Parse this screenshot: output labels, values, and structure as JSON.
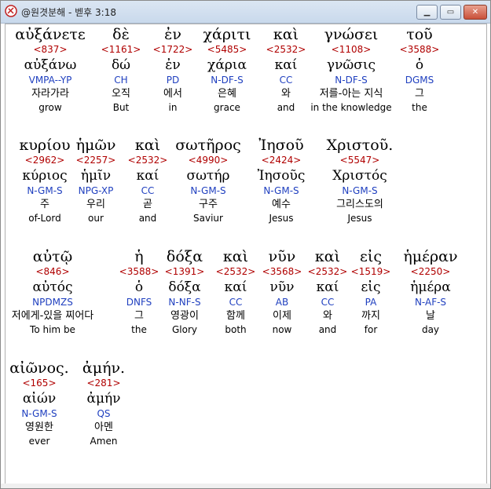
{
  "window": {
    "title": "@원겻분해 - 벧후 3:18"
  },
  "words": [
    {
      "greek": "αὐξάνετε",
      "num": "<837>",
      "lemma": "αὐξάνω",
      "parse": "VMPA--YP",
      "kor": "자라가라",
      "eng": "grow"
    },
    {
      "greek": "δὲ",
      "num": "<1161>",
      "lemma": "δώ",
      "parse": "CH",
      "kor": "오직",
      "eng": "But"
    },
    {
      "greek": "ἐν",
      "num": "<1722>",
      "lemma": "ἐν",
      "parse": "PD",
      "kor": "에서",
      "eng": "in"
    },
    {
      "greek": "χάριτι",
      "num": "<5485>",
      "lemma": "χάρια",
      "parse": "N-DF-S",
      "kor": "은혜",
      "eng": "grace"
    },
    {
      "greek": "καὶ",
      "num": "<2532>",
      "lemma": "καί",
      "parse": "CC",
      "kor": "와",
      "eng": "and"
    },
    {
      "greek": "γνώσει",
      "num": "<1108>",
      "lemma": "γνῶσις",
      "parse": "N-DF-S",
      "kor": "저를-아는 지식",
      "eng": "in the knowledge"
    },
    {
      "greek": "τοῦ",
      "num": "<3588>",
      "lemma": "ὁ",
      "parse": "DGMS",
      "kor": "그",
      "eng": "the"
    },
    {
      "greek": "κυρίου",
      "num": "<2962>",
      "lemma": "κύριος",
      "parse": "N-GM-S",
      "kor": "주",
      "eng": "of-Lord"
    },
    {
      "greek": "ἡμῶν",
      "num": "<2257>",
      "lemma": "ἡμῖν",
      "parse": "NPG-XP",
      "kor": "우리",
      "eng": "our"
    },
    {
      "greek": "καὶ",
      "num": "<2532>",
      "lemma": "καί",
      "parse": "CC",
      "kor": "곧",
      "eng": "and"
    },
    {
      "greek": "σωτῆρος",
      "num": "<4990>",
      "lemma": "σωτήρ",
      "parse": "N-GM-S",
      "kor": "구주",
      "eng": "Saviur"
    },
    {
      "greek": "Ἰησοῦ",
      "num": "<2424>",
      "lemma": "Ἰησοῦς",
      "parse": "N-GM-S",
      "kor": "예수",
      "eng": "Jesus"
    },
    {
      "greek": "Χριστοῦ.",
      "num": "<5547>",
      "lemma": "Χριστός",
      "parse": "N-GM-S",
      "kor": "그리스도의",
      "eng": "Jesus"
    },
    {
      "greek": "αὐτῷ",
      "num": "<846>",
      "lemma": "αὐτός",
      "parse": "NPDMZS",
      "kor": "저에게-있을 찌어다",
      "eng": "To him be"
    },
    {
      "greek": "ἡ",
      "num": "<3588>",
      "lemma": "ὁ",
      "parse": "DNFS",
      "kor": "그",
      "eng": "the"
    },
    {
      "greek": "δόξα",
      "num": "<1391>",
      "lemma": "δόξα",
      "parse": "N-NF-S",
      "kor": "영광이",
      "eng": "Glory"
    },
    {
      "greek": "καὶ",
      "num": "<2532>",
      "lemma": "καί",
      "parse": "CC",
      "kor": "함께",
      "eng": "both"
    },
    {
      "greek": "νῦν",
      "num": "<3568>",
      "lemma": "νῦν",
      "parse": "AB",
      "kor": "이제",
      "eng": "now"
    },
    {
      "greek": "καὶ",
      "num": "<2532>",
      "lemma": "καί",
      "parse": "CC",
      "kor": "와",
      "eng": "and"
    },
    {
      "greek": "εἰς",
      "num": "<1519>",
      "lemma": "εἰς",
      "parse": "PA",
      "kor": "까지",
      "eng": "for"
    },
    {
      "greek": "ἡμέραν",
      "num": "<2250>",
      "lemma": "ἡμέρα",
      "parse": "N-AF-S",
      "kor": "날",
      "eng": "day"
    },
    {
      "greek": "αἰῶνος.",
      "num": "<165>",
      "lemma": "αἰών",
      "parse": "N-GM-S",
      "kor": "영원한",
      "eng": "ever"
    },
    {
      "greek": "ἀμήν.",
      "num": "<281>",
      "lemma": "ἀμήν",
      "parse": "QS",
      "kor": "아멘",
      "eng": "Amen"
    }
  ]
}
